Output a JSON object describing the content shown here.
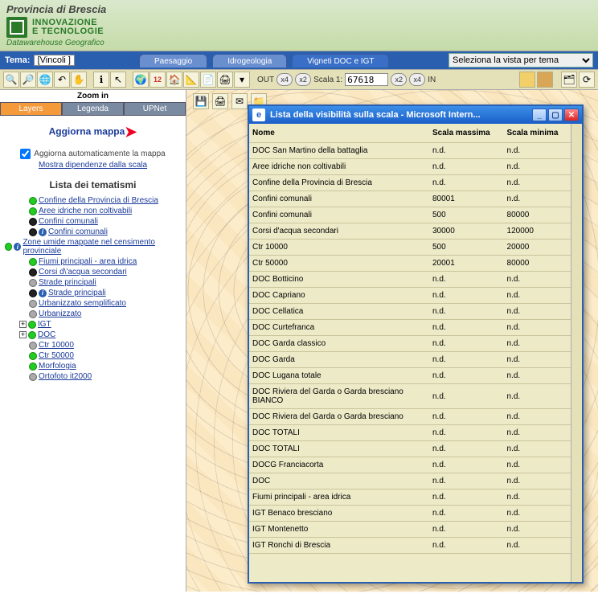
{
  "header": {
    "province": "Provincia di Brescia",
    "logo_line1": "INNOVAZIONE",
    "logo_line2": "E TECNOLOGIE",
    "subtitle": "Datawarehouse Geografico"
  },
  "tema": {
    "label": "Tema:",
    "value": "[Vincoli ]"
  },
  "tabs": [
    "Paesaggio",
    "Idrogeologia",
    "Vigneti DOC e IGT"
  ],
  "vista_placeholder": "Seleziona la vista per tema",
  "scale": {
    "out": "OUT",
    "in": "IN",
    "x4": "x4",
    "x2": "x2",
    "label": "Scala 1:",
    "value": "67618"
  },
  "zoom_label": "Zoom in",
  "left_tabs": [
    "Layers",
    "Legenda",
    "UPNet"
  ],
  "aggiorna": "Aggiorna mappa",
  "auto_label": "Aggiorna automaticamente la mappa",
  "deps_link": "Mostra dipendenze dalla scala",
  "tematismi_title": "Lista dei tematismi",
  "tree": [
    {
      "lvl": 1,
      "dot": "g",
      "label": "Confine della Provincia di Brescia"
    },
    {
      "lvl": 1,
      "dot": "g",
      "label": "Aree idriche non coltivabili"
    },
    {
      "lvl": 1,
      "dot": "k",
      "label": "Confini comunali"
    },
    {
      "lvl": 1,
      "dot": "k",
      "info": true,
      "label": "Confini comunali"
    },
    {
      "lvl": 0,
      "dot": "g",
      "info": true,
      "label": "Zone umide mappate nel censimento provinciale",
      "wrap": true
    },
    {
      "lvl": 1,
      "dot": "g",
      "label": "Fiumi principali - area idrica"
    },
    {
      "lvl": 1,
      "dot": "k",
      "label": "Corsi d\\'acqua secondari"
    },
    {
      "lvl": 1,
      "dot": "gray",
      "label": "Strade principali"
    },
    {
      "lvl": 1,
      "dot": "k",
      "info": true,
      "label": "Strade principali"
    },
    {
      "lvl": 1,
      "dot": "gray",
      "label": "Urbanizzato semplificato"
    },
    {
      "lvl": 1,
      "dot": "gray",
      "label": "Urbanizzato"
    },
    {
      "lvl": 0,
      "exp": "+",
      "dot": "g",
      "label": "IGT"
    },
    {
      "lvl": 0,
      "exp": "+",
      "dot": "g",
      "label": "DOC"
    },
    {
      "lvl": 1,
      "dot": "gray",
      "label": "Ctr 10000"
    },
    {
      "lvl": 1,
      "dot": "g",
      "label": "Ctr 50000"
    },
    {
      "lvl": 1,
      "dot": "g",
      "label": "Morfologia"
    },
    {
      "lvl": 1,
      "dot": "gray",
      "label": "Ortofoto it2000"
    }
  ],
  "popup": {
    "title": "Lista della visibilità sulla scala - Microsoft Intern...",
    "columns": [
      "Nome",
      "Scala massima",
      "Scala minima"
    ],
    "rows": [
      [
        "DOC San Martino della battaglia",
        "n.d.",
        "n.d."
      ],
      [
        "Aree idriche non coltivabili",
        "n.d.",
        "n.d."
      ],
      [
        "Confine della Provincia di Brescia",
        "n.d.",
        "n.d."
      ],
      [
        "Confini comunali",
        "80001",
        "n.d."
      ],
      [
        "Confini comunali",
        "500",
        "80000"
      ],
      [
        "Corsi d'acqua secondari",
        "30000",
        "120000"
      ],
      [
        "Ctr 10000",
        "500",
        "20000"
      ],
      [
        "Ctr 50000",
        "20001",
        "80000"
      ],
      [
        "DOC Botticino",
        "n.d.",
        "n.d."
      ],
      [
        "DOC Capriano",
        "n.d.",
        "n.d."
      ],
      [
        "DOC Cellatica",
        "n.d.",
        "n.d."
      ],
      [
        "DOC Curtefranca",
        "n.d.",
        "n.d."
      ],
      [
        "DOC Garda classico",
        "n.d.",
        "n.d."
      ],
      [
        "DOC Garda",
        "n.d.",
        "n.d."
      ],
      [
        "DOC Lugana totale",
        "n.d.",
        "n.d."
      ],
      [
        "DOC Riviera del Garda o Garda bresciano BIANCO",
        "n.d.",
        "n.d."
      ],
      [
        "DOC Riviera del Garda o Garda bresciano",
        "n.d.",
        "n.d."
      ],
      [
        "DOC TOTALI",
        "n.d.",
        "n.d."
      ],
      [
        "DOC TOTALI",
        "n.d.",
        "n.d."
      ],
      [
        "DOCG Franciacorta",
        "n.d.",
        "n.d."
      ],
      [
        "DOC",
        "n.d.",
        "n.d."
      ],
      [
        "Fiumi principali - area idrica",
        "n.d.",
        "n.d."
      ],
      [
        "IGT Benaco bresciano",
        "n.d.",
        "n.d."
      ],
      [
        "IGT Montenetto",
        "n.d.",
        "n.d."
      ],
      [
        "IGT Ronchi di Brescia",
        "n.d.",
        "n.d."
      ]
    ]
  }
}
